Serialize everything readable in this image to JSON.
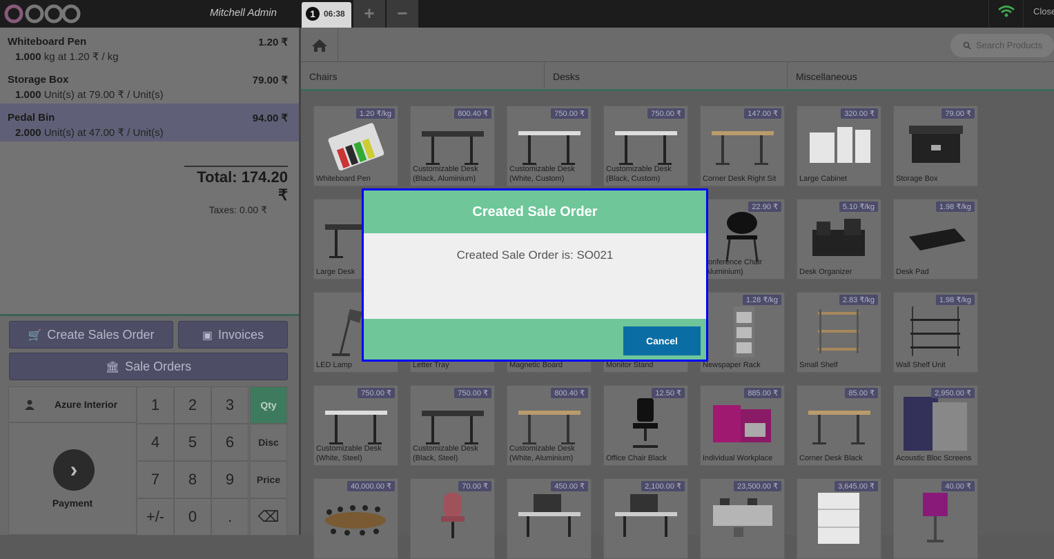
{
  "topbar": {
    "logo": "odoo",
    "user": "Mitchell Admin",
    "order_number": "1",
    "order_time": "06:38",
    "add_label": "+",
    "remove_label": "−",
    "close_label": "Close"
  },
  "order": {
    "lines": [
      {
        "name": "Whiteboard Pen",
        "price": "1.20 ₹",
        "qty": "1.000",
        "info": " kg at 1.20 ₹ / kg"
      },
      {
        "name": "Storage Box",
        "price": "79.00 ₹",
        "qty": "1.000",
        "info": " Unit(s) at 79.00 ₹ / Unit(s)"
      },
      {
        "name": "Pedal Bin",
        "price": "94.00 ₹",
        "qty": "2.000",
        "info": " Unit(s) at 47.00 ₹ / Unit(s)"
      }
    ],
    "total": "Total: 174.20 ₹",
    "taxes": "Taxes: 0.00 ₹"
  },
  "controls": {
    "create_sales_order": "Create Sales Order",
    "invoices": "Invoices",
    "sale_orders": "Sale Orders"
  },
  "numpad": {
    "customer": "Azure Interior",
    "payment": "Payment",
    "keys": [
      "1",
      "2",
      "3",
      "4",
      "5",
      "6",
      "7",
      "8",
      "9",
      "+/-",
      "0",
      "."
    ],
    "qty": "Qty",
    "disc": "Disc",
    "price": "Price",
    "backspace": "⌫"
  },
  "products_header": {
    "search_placeholder": "Search Products",
    "categories": [
      "Chairs",
      "Desks",
      "Miscellaneous"
    ]
  },
  "products": [
    {
      "name": "Whiteboard Pen",
      "price": "1.20 ₹/kg",
      "icon": "pen"
    },
    {
      "name": "Customizable Desk (Black, Aluminium)",
      "price": "800.40 ₹",
      "icon": "desk-black"
    },
    {
      "name": "Customizable Desk (White, Custom)",
      "price": "750.00 ₹",
      "icon": "desk-white"
    },
    {
      "name": "Customizable Desk (Black, Custom)",
      "price": "750.00 ₹",
      "icon": "desk-white"
    },
    {
      "name": "Corner Desk Right Sit",
      "price": "147.00 ₹",
      "icon": "desk-wood"
    },
    {
      "name": "Large Cabinet",
      "price": "320.00 ₹",
      "icon": "cabinet"
    },
    {
      "name": "Storage Box",
      "price": "79.00 ₹",
      "icon": "box"
    },
    {
      "name": "Large Desk",
      "price": "",
      "icon": "desk-black"
    },
    {
      "name": "",
      "price": "",
      "icon": "none"
    },
    {
      "name": "",
      "price": "",
      "icon": "none"
    },
    {
      "name": "",
      "price": "",
      "icon": "none"
    },
    {
      "name": "Conference Chair (Aluminium)",
      "price": "22.90 ₹",
      "icon": "chair"
    },
    {
      "name": "Desk Organizer",
      "price": "5.10 ₹/kg",
      "icon": "organizer"
    },
    {
      "name": "Desk Pad",
      "price": "1.98 ₹/kg",
      "icon": "pad"
    },
    {
      "name": "LED Lamp",
      "price": "",
      "icon": "lamp"
    },
    {
      "name": "Letter Tray",
      "price": "",
      "icon": "none"
    },
    {
      "name": "Magnetic Board",
      "price": "",
      "icon": "none"
    },
    {
      "name": "Monitor Stand",
      "price": "",
      "icon": "none"
    },
    {
      "name": "Newspaper Rack",
      "price": "1.28 ₹/kg",
      "icon": "rack"
    },
    {
      "name": "Small Shelf",
      "price": "2.83 ₹/kg",
      "icon": "shelf"
    },
    {
      "name": "Wall Shelf Unit",
      "price": "1.98 ₹/kg",
      "icon": "wallshelf"
    },
    {
      "name": "Customizable Desk (White, Steel)",
      "price": "750.00 ₹",
      "icon": "desk-white"
    },
    {
      "name": "Customizable Desk (Black, Steel)",
      "price": "750.00 ₹",
      "icon": "desk-black"
    },
    {
      "name": "Customizable Desk (White, Aluminium)",
      "price": "800.40 ₹",
      "icon": "desk-wood"
    },
    {
      "name": "Office Chair Black",
      "price": "12.50 ₹",
      "icon": "officechair"
    },
    {
      "name": "Individual Workplace",
      "price": "885.00 ₹",
      "icon": "workplace"
    },
    {
      "name": "Corner Desk Black",
      "price": "85.00 ₹",
      "icon": "desk-wood"
    },
    {
      "name": "Acoustic Bloc Screens",
      "price": "2,950.00 ₹",
      "icon": "screens"
    },
    {
      "name": "",
      "price": "40,000.00 ₹",
      "icon": "conference"
    },
    {
      "name": "",
      "price": "70.00 ₹",
      "icon": "pinkchair"
    },
    {
      "name": "",
      "price": "450.00 ₹",
      "icon": "deskscreen"
    },
    {
      "name": "",
      "price": "2,100.00 ₹",
      "icon": "deskscreen"
    },
    {
      "name": "",
      "price": "23,500.00 ₹",
      "icon": "cubicle"
    },
    {
      "name": "",
      "price": "3,645.00 ₹",
      "icon": "drawer"
    },
    {
      "name": "",
      "price": "40.00 ₹",
      "icon": "pinklamp"
    }
  ],
  "modal": {
    "title": "Created Sale Order",
    "message": "Created Sale Order is: SO021",
    "cancel": "Cancel"
  },
  "colors": {
    "accent_green": "#6ec699",
    "button_blue": "#0a6ea5",
    "highlight_border": "#0000ff",
    "odoo_purple": "#875a7b"
  }
}
